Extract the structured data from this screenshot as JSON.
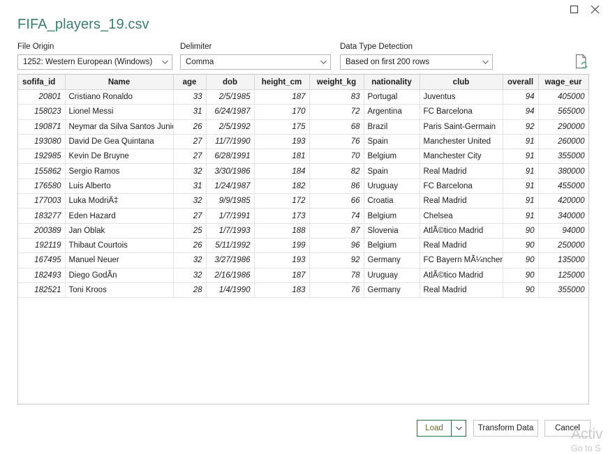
{
  "window": {
    "controls": [
      {
        "name": "maximize-button",
        "icon": "maximize-icon",
        "label": "Maximize"
      },
      {
        "name": "close-button",
        "icon": "close-icon",
        "label": "Close"
      }
    ]
  },
  "dialog": {
    "title": "FIFA_players_19.csv",
    "title_color": "#3c7d6e"
  },
  "options": {
    "file_origin": {
      "label": "File Origin",
      "value": "1252: Western European (Windows)"
    },
    "delimiter": {
      "label": "Delimiter",
      "value": "Comma"
    },
    "data_type_detection": {
      "label": "Data Type Detection",
      "value": "Based on first 200 rows"
    },
    "refresh_icon": "file-refresh-icon"
  },
  "grid": {
    "columns": [
      "sofifa_id",
      "Name",
      "age",
      "dob",
      "height_cm",
      "weight_kg",
      "nationality",
      "club",
      "overall",
      "wage_eur"
    ],
    "rows": [
      [
        "20801",
        "Cristiano Ronaldo",
        "33",
        "2/5/1985",
        "187",
        "83",
        "Portugal",
        "Juventus",
        "94",
        "405000"
      ],
      [
        "158023",
        "Lionel Messi",
        "31",
        "6/24/1987",
        "170",
        "72",
        "Argentina",
        "FC Barcelona",
        "94",
        "565000"
      ],
      [
        "190871",
        "Neymar da Silva Santos Junior",
        "26",
        "2/5/1992",
        "175",
        "68",
        "Brazil",
        "Paris Saint-Germain",
        "92",
        "290000"
      ],
      [
        "193080",
        "David De Gea Quintana",
        "27",
        "11/7/1990",
        "193",
        "76",
        "Spain",
        "Manchester United",
        "91",
        "260000"
      ],
      [
        "192985",
        "Kevin De Bruyne",
        "27",
        "6/28/1991",
        "181",
        "70",
        "Belgium",
        "Manchester City",
        "91",
        "355000"
      ],
      [
        "155862",
        "Sergio Ramos",
        "32",
        "3/30/1986",
        "184",
        "82",
        "Spain",
        "Real Madrid",
        "91",
        "380000"
      ],
      [
        "176580",
        "Luis Alberto",
        "31",
        "1/24/1987",
        "182",
        "86",
        "Uruguay",
        "FC Barcelona",
        "91",
        "455000"
      ],
      [
        "177003",
        "Luka ModriÄ‡",
        "32",
        "9/9/1985",
        "172",
        "66",
        "Croatia",
        "Real Madrid",
        "91",
        "420000"
      ],
      [
        "183277",
        "Eden Hazard",
        "27",
        "1/7/1991",
        "173",
        "74",
        "Belgium",
        "Chelsea",
        "91",
        "340000"
      ],
      [
        "200389",
        "Jan Oblak",
        "25",
        "1/7/1993",
        "188",
        "87",
        "Slovenia",
        "AtlÃ©tico Madrid",
        "90",
        "94000"
      ],
      [
        "192119",
        "Thibaut Courtois",
        "26",
        "5/11/1992",
        "199",
        "96",
        "Belgium",
        "Real Madrid",
        "90",
        "250000"
      ],
      [
        "167495",
        "Manuel Neuer",
        "32",
        "3/27/1986",
        "193",
        "92",
        "Germany",
        "FC Bayern MÃ¼nchen",
        "90",
        "135000"
      ],
      [
        "182493",
        "Diego GodÃ­n",
        "32",
        "2/16/1986",
        "187",
        "78",
        "Uruguay",
        "AtlÃ©tico Madrid",
        "90",
        "125000"
      ],
      [
        "182521",
        "Toni Kroos",
        "28",
        "1/4/1990",
        "183",
        "76",
        "Germany",
        "Real Madrid",
        "90",
        "355000"
      ]
    ]
  },
  "footer": {
    "load_label": "Load",
    "load_dropdown_icon": "chevron-down-icon",
    "transform_label": "Transform Data",
    "cancel_label": "Cancel"
  },
  "watermark": {
    "line1": "Activ",
    "line2": "Go to S"
  }
}
